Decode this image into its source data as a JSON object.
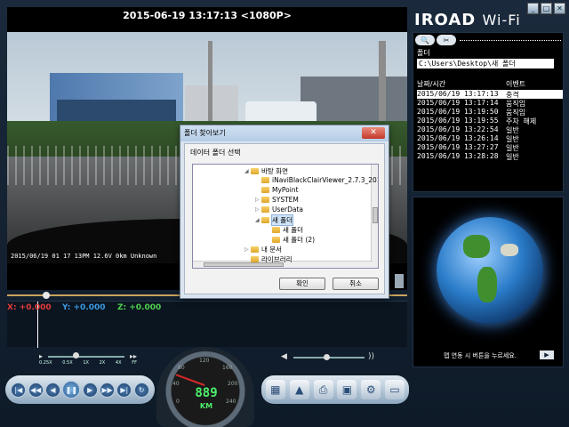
{
  "window": {
    "minimize_icon": "minimize-icon",
    "maximize_icon": "maximize-icon",
    "close_icon": "close-icon"
  },
  "brand": {
    "name": "IROAD",
    "suffix": "Wi-Fi"
  },
  "video": {
    "title": "2015-06-19 13:17:13 <1080P>",
    "stamp": "2015/06/19 01 17 13PM 12.6V  0km Unknown",
    "progress": 0.09
  },
  "gsensor": {
    "x_label": "X: +0.000",
    "y_label": "Y: +0.000",
    "z_label": "Z: +0.000",
    "x_color": "#e23b3b",
    "y_color": "#3b9be2",
    "z_color": "#4fd14f"
  },
  "playback_speed": {
    "labels": [
      "0.25X",
      "0.5X",
      "1X",
      "2X",
      "4X",
      "FF"
    ],
    "selected": "1X"
  },
  "speedometer": {
    "value": "889",
    "unit": "KM",
    "ticks": [
      "0",
      "40",
      "80",
      "120",
      "160",
      "200",
      "240"
    ]
  },
  "transport": [
    "first-icon",
    "rewind-icon",
    "step-back-icon",
    "play-icon",
    "step-forward-icon",
    "fast-forward-icon",
    "last-icon",
    "loop-icon"
  ],
  "tools": [
    "film-icon",
    "map-icon",
    "capture-icon",
    "save-icon",
    "settings-icon",
    "folder-icon"
  ],
  "files": {
    "folder_label": "폴더",
    "folder_path": "C:\\Users\\Desktop\\새 폴더",
    "col_datetime": "날짜/시간",
    "col_event": "이벤트",
    "rows": [
      {
        "dt": "2015/06/19 13:17:13",
        "ev": "충격",
        "selected": true
      },
      {
        "dt": "2015/06/19 13:17:14",
        "ev": "움직임"
      },
      {
        "dt": "2015/06/19 13:19:50",
        "ev": "움직임"
      },
      {
        "dt": "2015/06/19 13:19:55",
        "ev": "주차 해제"
      },
      {
        "dt": "2015/06/19 13:22:54",
        "ev": "일반"
      },
      {
        "dt": "2015/06/19 13:26:14",
        "ev": "일반"
      },
      {
        "dt": "2015/06/19 13:27:27",
        "ev": "일반"
      },
      {
        "dt": "2015/06/19 13:28:28",
        "ev": "일반"
      }
    ]
  },
  "map": {
    "message": "맵 연동 시 버튼을 누르세요.",
    "button_icon": "play-icon"
  },
  "dialog": {
    "title": "폴더 찾아보기",
    "prompt": "데이터 폴더 선택",
    "ok": "확인",
    "cancel": "취소",
    "tree": [
      {
        "label": "바탕 화면",
        "level": 0,
        "expanded": true
      },
      {
        "label": "iNaviBlackClairViewer_2.7.3_201",
        "level": 1
      },
      {
        "label": "MyPoint",
        "level": 1
      },
      {
        "label": "SYSTEM",
        "level": 1,
        "collapsed": true
      },
      {
        "label": "UserData",
        "level": 1,
        "collapsed": true
      },
      {
        "label": "새 폴더",
        "level": 1,
        "expanded": true,
        "selected": true
      },
      {
        "label": "새 폴더",
        "level": 2
      },
      {
        "label": "새 폴더 (2)",
        "level": 2
      },
      {
        "label": "내 문서",
        "level": 0,
        "collapsed": true
      },
      {
        "label": "라이브러리",
        "level": 0
      }
    ]
  }
}
